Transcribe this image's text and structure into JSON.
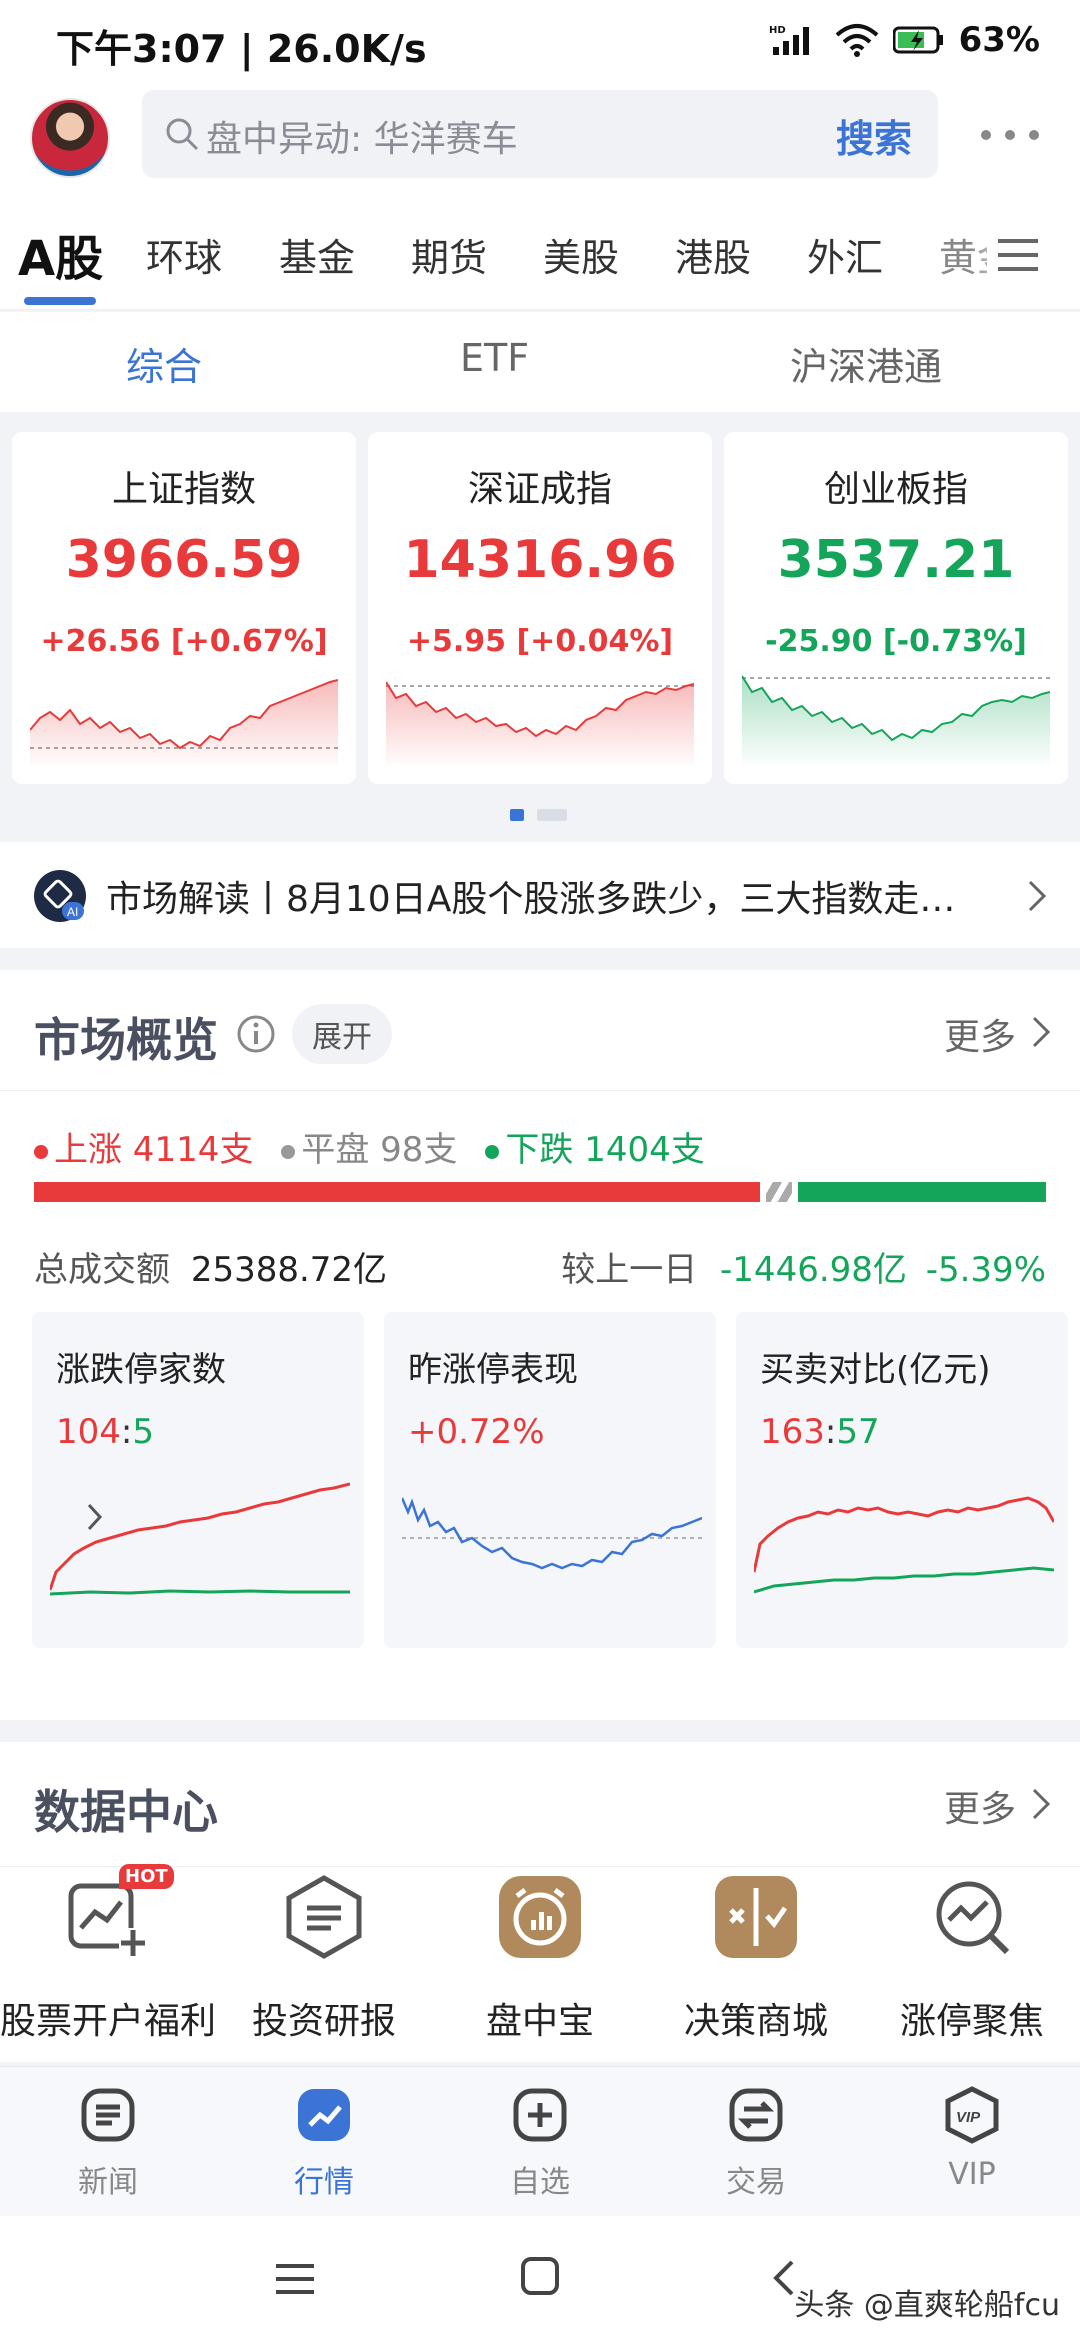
{
  "status": {
    "time_net": "下午3:07 | 26.0K/s",
    "battery": "63%"
  },
  "search": {
    "placeholder": "盘中异动: 华洋赛车",
    "button": "搜索"
  },
  "market_tabs": [
    "A股",
    "环球",
    "基金",
    "期货",
    "美股",
    "港股",
    "外汇",
    "黄金"
  ],
  "sub_tabs": [
    "综合",
    "ETF",
    "沪深港通"
  ],
  "indices": [
    {
      "name": "上证指数",
      "value": "3966.59",
      "change": "+26.56 [+0.67%]",
      "dir": "up"
    },
    {
      "name": "深证成指",
      "value": "14316.96",
      "change": "+5.95 [+0.04%]",
      "dir": "up"
    },
    {
      "name": "创业板指",
      "value": "3537.21",
      "change": "-25.90 [-0.73%]",
      "dir": "down"
    }
  ],
  "market_read": {
    "text": "市场解读丨8月10日A股个股涨多跌少，三大指数走…"
  },
  "overview": {
    "title": "市场概览",
    "expand": "展开",
    "more": "更多",
    "up_label": "上涨 4114支",
    "flat_label": "平盘 98支",
    "down_label": "下跌 1404支",
    "up_count": 4114,
    "flat_count": 98,
    "down_count": 1404,
    "turnover_label": "总成交额",
    "turnover_value": "25388.72亿",
    "compare_label": "较上一日",
    "compare_value": "-1446.98亿",
    "compare_pct": "-5.39%",
    "cards": [
      {
        "title": "涨跌停家数",
        "v1": "104",
        "v2": "5"
      },
      {
        "title": "昨涨停表现",
        "v1": "+0.72%"
      },
      {
        "title": "买卖对比(亿元)",
        "v1": "163",
        "v2": "57"
      }
    ]
  },
  "datacenter": {
    "title": "数据中心",
    "more": "更多",
    "hot_badge": "HOT",
    "items": [
      "股票开户福利",
      "投资研报",
      "盘中宝",
      "决策商城",
      "涨停聚焦"
    ]
  },
  "bottom_nav": [
    "新闻",
    "行情",
    "自选",
    "交易",
    "VIP"
  ],
  "watermark": "头条 @直爽轮船fcu",
  "colors": {
    "up": "#e83a3a",
    "down": "#14a55a",
    "accent": "#3b74d4"
  }
}
